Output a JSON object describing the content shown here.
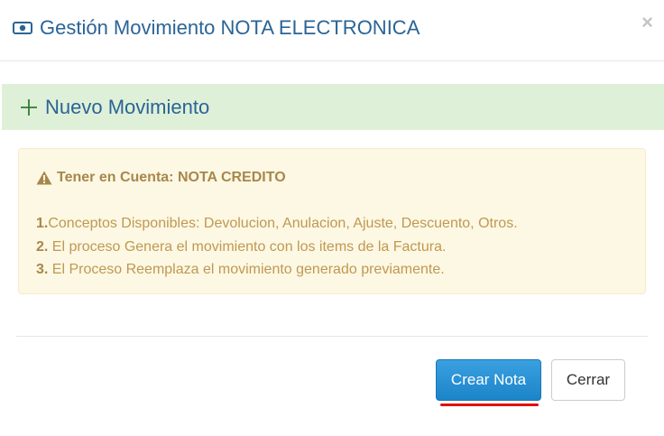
{
  "modal": {
    "title": "Gestión Movimiento NOTA ELECTRONICA",
    "title_icon": "money-icon",
    "close_label": "×"
  },
  "panel": {
    "icon": "plus-icon",
    "heading": "Nuevo Movimiento"
  },
  "alert": {
    "icon": "warning-icon",
    "heading": "Tener en Cuenta: NOTA CREDITO",
    "items": [
      {
        "num": "1.",
        "text": "Conceptos Disponibles: Devolucion, Anulacion, Ajuste, Descuento, Otros."
      },
      {
        "num": "2.",
        "text": " El proceso Genera el movimiento con los items de la Factura."
      },
      {
        "num": "3.",
        "text": " El Proceso Reemplaza el movimiento generado previamente."
      }
    ]
  },
  "footer": {
    "create_label": "Crear Nota",
    "close_label": "Cerrar"
  },
  "colors": {
    "title": "#2a6496",
    "panel_bg": "#dff0d8",
    "alert_bg": "#fcf8e3",
    "alert_text": "#c09853",
    "primary_btn": "#1b84c8",
    "highlight": "#e01010"
  }
}
